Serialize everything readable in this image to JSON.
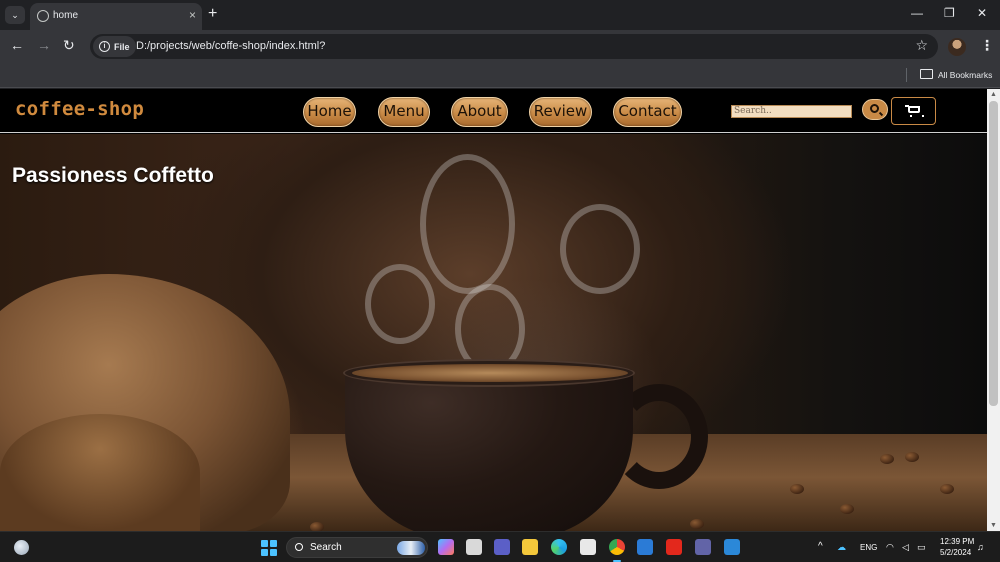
{
  "browser": {
    "tab_title": "home",
    "new_tab_symbol": "+",
    "tab_close_symbol": "×",
    "tab_search_symbol": "⌄",
    "site_info_label": "File",
    "url": "D:/projects/web/coffe-shop/index.html?",
    "bookmarks_label": "All Bookmarks",
    "icons": [
      "back-icon",
      "forward-icon",
      "reload-icon",
      "star-icon",
      "profile-avatar",
      "kebab-menu-icon",
      "folder-icon"
    ],
    "back_symbol": "←",
    "forward_symbol": "→",
    "reload_symbol": "↻",
    "star_symbol": "☆",
    "kebab_symbol": "⋮",
    "window_controls": {
      "minimize": "—",
      "restore": "❐",
      "close": "✕"
    }
  },
  "site": {
    "logo": "coffee-shop",
    "nav": [
      "Home",
      "Menu",
      "About",
      "Review",
      "Contact"
    ],
    "search_placeholder": "Search..",
    "hero_title": "Passioness Coffetto",
    "accent_color": "#c98a46"
  },
  "taskbar": {
    "search_label": "Search",
    "tray": {
      "language": "ENG",
      "time": "12:39 PM",
      "date": "5/2/2024",
      "chevron": "^"
    }
  }
}
